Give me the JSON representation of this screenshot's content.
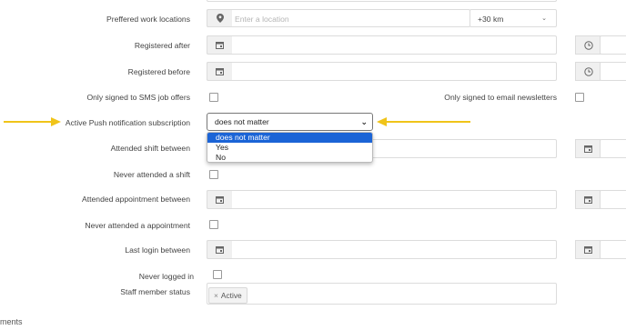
{
  "fields": {
    "work_locations": {
      "label": "Preffered work locations",
      "placeholder": "Enter a location",
      "distance": "+30 km"
    },
    "registered_after": {
      "label": "Registered after"
    },
    "registered_before": {
      "label": "Registered before"
    },
    "sms_offers": {
      "label": "Only signed to SMS job offers"
    },
    "email_newsletters": {
      "label": "Only signed to email newsletters"
    },
    "push_subscription": {
      "label": "Active Push notification subscription",
      "value": "does not matter",
      "options": [
        "does not matter",
        "Yes",
        "No"
      ]
    },
    "attended_shift_between": {
      "label": "Attended shift between"
    },
    "never_attended_shift": {
      "label": "Never attended a shift"
    },
    "attended_appointment_between": {
      "label": "Attended appointment between"
    },
    "never_attended_appointment": {
      "label": "Never attended a appointment"
    },
    "last_login_between": {
      "label": "Last login between"
    },
    "never_logged_in": {
      "label": "Never logged in"
    },
    "staff_status": {
      "label": "Staff member status",
      "tag": "Active",
      "tag_remove": "×"
    }
  },
  "footer_fragment": "ments",
  "colors": {
    "arrow": "#f0c419",
    "selected_option": "#1b64d6"
  }
}
